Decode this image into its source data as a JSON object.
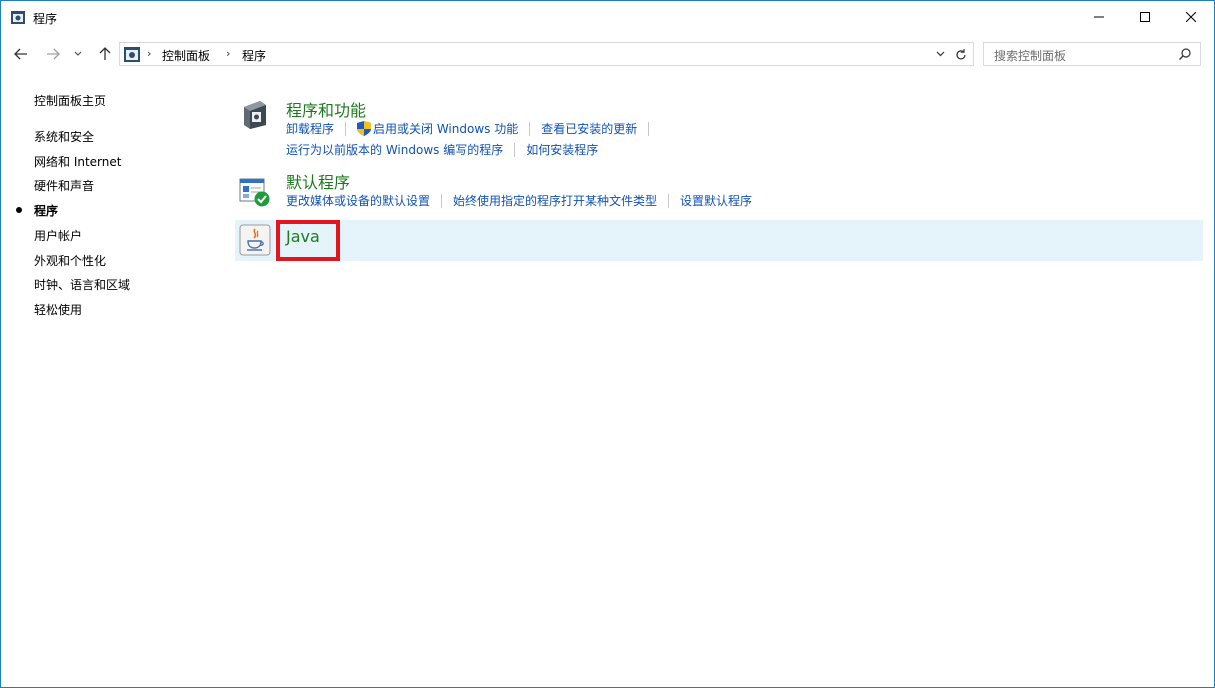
{
  "window": {
    "title": "程序",
    "controls": {
      "minimize": "minimize-icon",
      "maximize": "maximize-icon",
      "close": "close-icon"
    }
  },
  "nav": {
    "breadcrumb": [
      "控制面板",
      "程序"
    ],
    "search_placeholder": "搜索控制面板"
  },
  "sidebar": {
    "home": "控制面板主页",
    "items": [
      {
        "label": "系统和安全",
        "active": false
      },
      {
        "label": "网络和 Internet",
        "active": false
      },
      {
        "label": "硬件和声音",
        "active": false
      },
      {
        "label": "程序",
        "active": true
      },
      {
        "label": "用户帐户",
        "active": false
      },
      {
        "label": "外观和个性化",
        "active": false
      },
      {
        "label": "时钟、语言和区域",
        "active": false
      },
      {
        "label": "轻松使用",
        "active": false
      }
    ]
  },
  "categories": {
    "programs_features": {
      "title": "程序和功能",
      "links_row1": [
        "卸载程序",
        "启用或关闭 Windows 功能",
        "查看已安装的更新"
      ],
      "links_row2": [
        "运行为以前版本的 Windows 编写的程序",
        "如何安装程序"
      ]
    },
    "default_programs": {
      "title": "默认程序",
      "links": [
        "更改媒体或设备的默认设置",
        "始终使用指定的程序打开某种文件类型",
        "设置默认程序"
      ]
    },
    "java": {
      "title": "Java"
    }
  },
  "colors": {
    "category_title": "#1e7a1e",
    "link": "#0f52b8",
    "selected_row": "#e5f3fb",
    "highlight_box": "#e2161f",
    "window_border": "#1f7fbf"
  }
}
